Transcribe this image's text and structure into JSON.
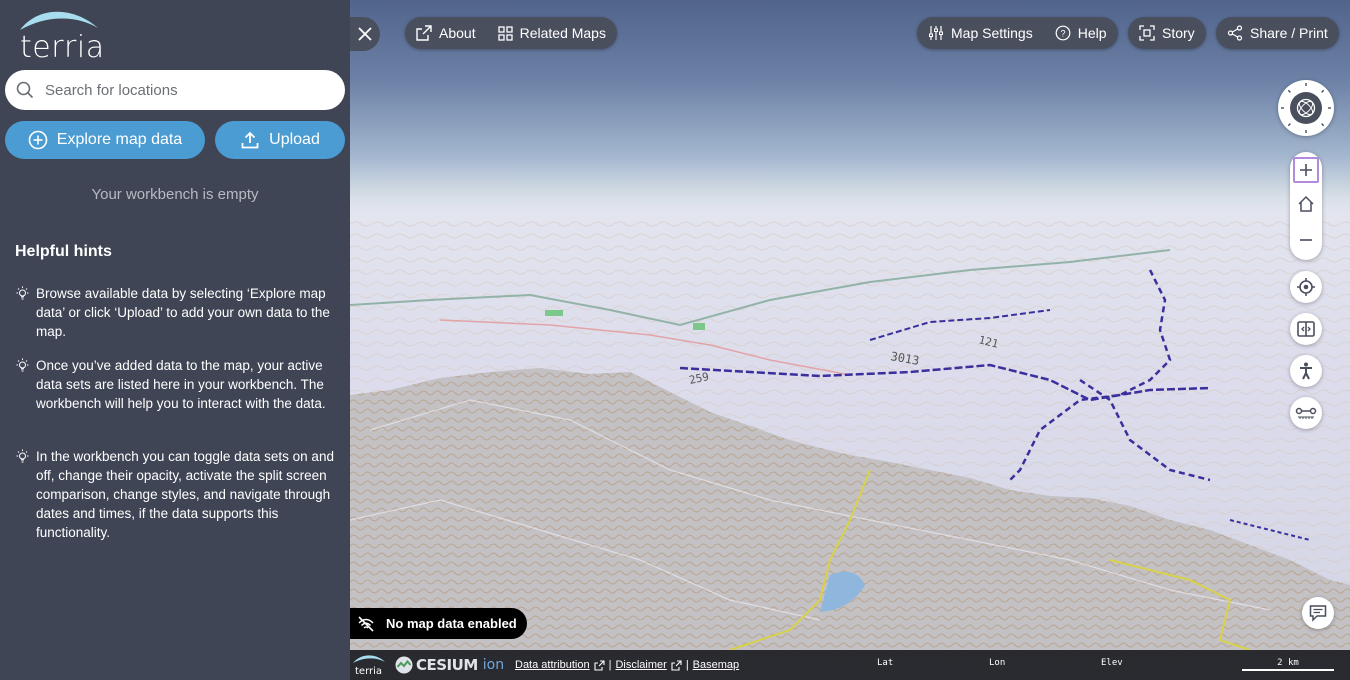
{
  "sidebar": {
    "logo_text": "terria",
    "search_placeholder": "Search for locations",
    "explore_label": "Explore map data",
    "upload_label": "Upload",
    "workbench_empty": "Your workbench is empty",
    "hints_title": "Helpful hints",
    "hints": [
      "Browse available data by selecting ‘Explore map data’ or click ‘Upload’ to add your own data to the map.",
      "Once you’ve added data to the map, your active data sets are listed here in your workbench. The workbench will help you to interact with the data.",
      "In the workbench you can toggle data sets on and off, change their opacity, activate the split screen comparison, change styles, and navigate through dates and times, if the data supports this functionality."
    ]
  },
  "toolbar": {
    "about": "About",
    "related_maps": "Related Maps",
    "map_settings": "Map Settings",
    "help": "Help",
    "story": "Story",
    "share": "Share / Print"
  },
  "map": {
    "no_data": "No map data enabled",
    "road_labels": [
      "3013",
      "121",
      "259"
    ]
  },
  "bottombar": {
    "cesium": "CESIUM",
    "ion": "ion",
    "data_attribution": "Data attribution",
    "disclaimer": "Disclaimer",
    "basemap": "Basemap",
    "sep": "|",
    "lat": "Lat",
    "lon": "Lon",
    "elev": "Elev",
    "scale": "2 km"
  },
  "colors": {
    "sidebar_bg": "#3f4554",
    "accent_blue": "#4b9cd3",
    "pill_bg": "#4a4f5e",
    "zoom_highlight": "#b38bdc"
  }
}
